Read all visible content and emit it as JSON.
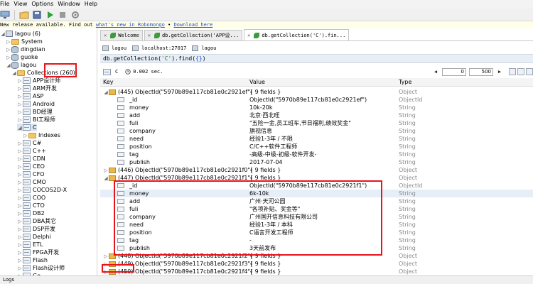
{
  "menu": [
    "File",
    "View",
    "Options",
    "Window",
    "Help"
  ],
  "notice": {
    "text": "New release available. Find out ",
    "link1": "what's new in Robomongo",
    "sep": " • ",
    "link2": "Download here"
  },
  "sidebar": {
    "server": "lagou (6)",
    "dbs": [
      "System",
      "dingdian",
      "guoke",
      "lagou"
    ],
    "collections_label": "Collections (260)",
    "collections": [
      "APP设计师",
      "ARM开发",
      "ASP",
      "Android",
      "BD经理",
      "BI工程师",
      "C",
      "Indexes",
      "C#",
      "C++",
      "CDN",
      "CEO",
      "CFO",
      "CMO",
      "COCOS2D-X",
      "COO",
      "CTO",
      "DB2",
      "DBA其它",
      "DSP开发",
      "Delphi",
      "ETL",
      "FPGA开发",
      "Flash",
      "Flash设计师",
      "Go"
    ]
  },
  "tabs": [
    {
      "label": "Welcome"
    },
    {
      "label": "db.getCollection('APP设..."
    },
    {
      "label": "db.getCollection('C').fin..."
    }
  ],
  "connection": {
    "db": "lagou",
    "host": "localhost:27017",
    "collection": "lagou"
  },
  "query": {
    "prefix": "db.getCollection(",
    "arg": "'C'",
    "suffix": ").find(",
    "braces": "{}",
    "close": ")"
  },
  "result": {
    "collection": "C",
    "time": "0.002 sec.",
    "page_start": "0",
    "page_size": "500"
  },
  "grid": {
    "headers": {
      "key": "Key",
      "value": "Value",
      "type": "Type"
    },
    "rows": [
      {
        "key": "(445) ObjectId(\"5970b89e117cb81e0c2921ef\")",
        "value": "{ 9 fields }",
        "type": "Object",
        "doc": true
      },
      {
        "key": "_id",
        "value": "ObjectId(\"5970b89e117cb81e0c2921ef\")",
        "type": "ObjectId"
      },
      {
        "key": "money",
        "value": "10k-20k",
        "type": "String"
      },
      {
        "key": "add",
        "value": "北京·西北旺",
        "type": "String"
      },
      {
        "key": "fuli",
        "value": "\"五险一金,员工班车,节日福利,绩效奖金\"",
        "type": "String"
      },
      {
        "key": "company",
        "value": "旗视信息",
        "type": "String"
      },
      {
        "key": "need",
        "value": "经验1-3年 / 不限",
        "type": "String"
      },
      {
        "key": "position",
        "value": "C/C++软件工程师",
        "type": "String"
      },
      {
        "key": "tag",
        "value": "-高级-中级-初级-软件开发-",
        "type": "String"
      },
      {
        "key": "publish",
        "value": "2017-07-04",
        "type": "String"
      },
      {
        "key": "(446) ObjectId(\"5970b89e117cb81e0c2921f0\")",
        "value": "{ 9 fields }",
        "type": "Object",
        "doc": true
      },
      {
        "key": "(447) ObjectId(\"5970b89e117cb81e0c2921f1\")",
        "value": "{ 9 fields }",
        "type": "Object",
        "doc": true
      },
      {
        "key": "_id",
        "value": "ObjectId(\"5970b89e117cb81e0c2921f1\")",
        "type": "ObjectId"
      },
      {
        "key": "money",
        "value": "6k-10k",
        "type": "String"
      },
      {
        "key": "add",
        "value": "广州·天河公园",
        "type": "String"
      },
      {
        "key": "fuli",
        "value": "\"各项补贴、奖金等\"",
        "type": "String"
      },
      {
        "key": "company",
        "value": "广州国开信息科技有限公司",
        "type": "String"
      },
      {
        "key": "need",
        "value": "经验1-3年 / 本科",
        "type": "String"
      },
      {
        "key": "position",
        "value": "C语言开发工程师",
        "type": "String"
      },
      {
        "key": "tag",
        "value": "-",
        "type": "String"
      },
      {
        "key": "publish",
        "value": "3天前发布",
        "type": "String"
      },
      {
        "key": "(448) ObjectId(\"5970b89e117cb81e0c2921f2\")",
        "value": "{ 9 fields }",
        "type": "Object",
        "doc": true
      },
      {
        "key": "(449) ObjectId(\"5970b89e117cb81e0c2921f3\")",
        "value": "{ 9 fields }",
        "type": "Object",
        "doc": true
      },
      {
        "key": "(450) ObjectId(\"5970b89e117cb81e0c2921f4\")",
        "value": "{ 9 fields }",
        "type": "Object",
        "doc": true
      }
    ]
  },
  "status": "Logs",
  "colors": {
    "highlight": "#e8141c",
    "folder": "#f3c564",
    "selection": "#e6eef8"
  }
}
